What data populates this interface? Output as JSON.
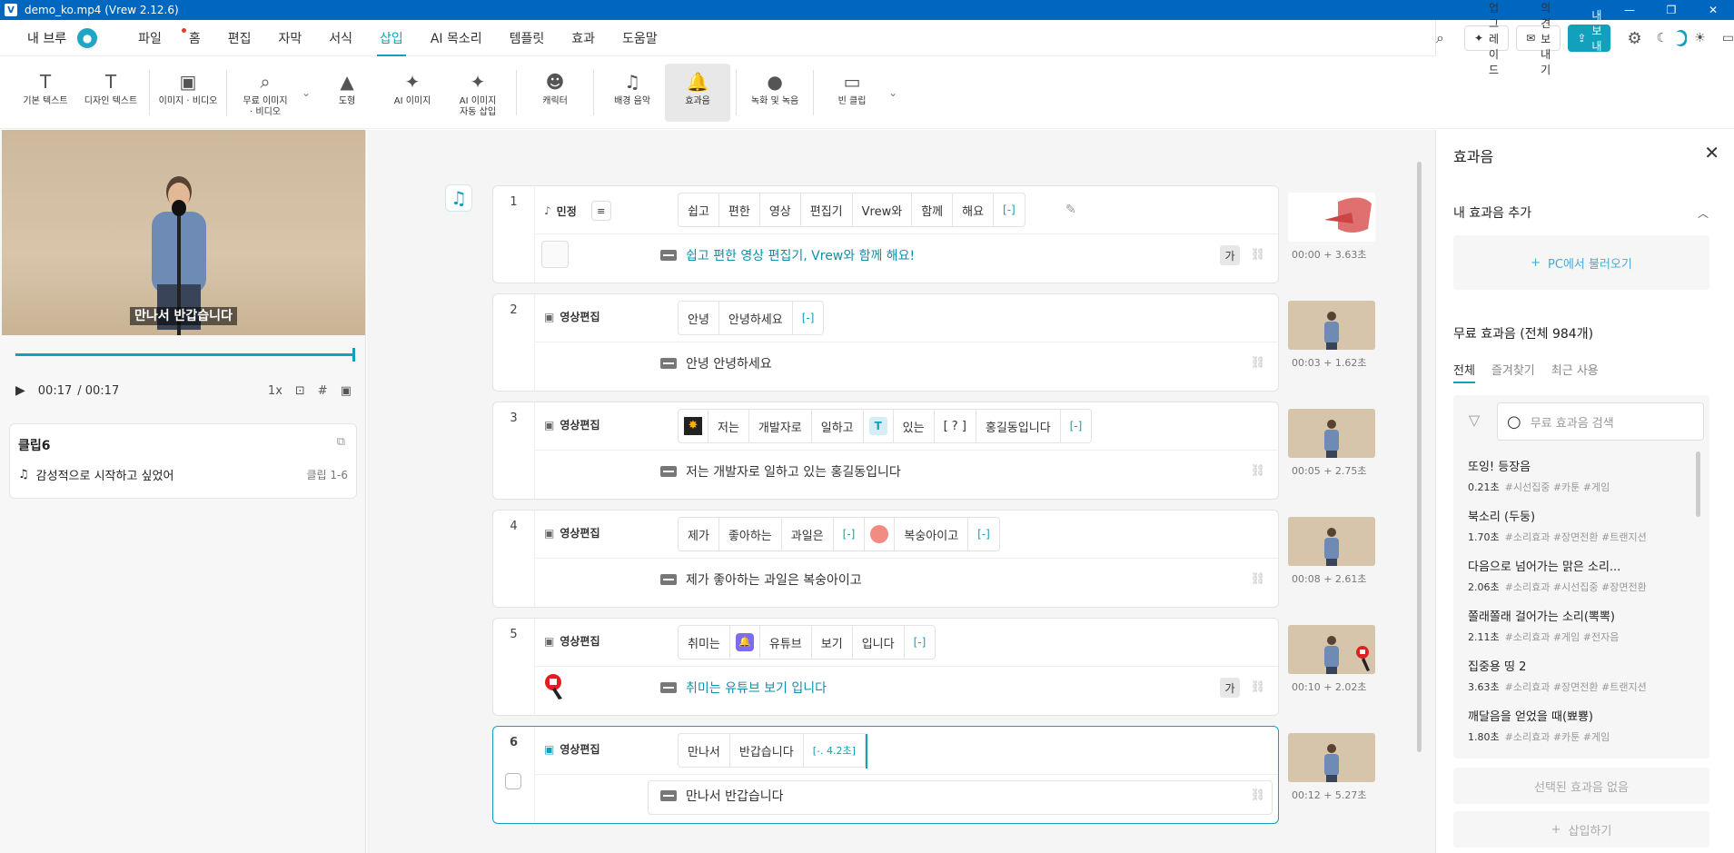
{
  "window": {
    "title": "demo_ko.mp4 (Vrew 2.12.6)",
    "controls": [
      "—",
      "❐",
      "✕"
    ]
  },
  "menubar": {
    "user": "내 브루",
    "items": [
      "파일",
      "홈",
      "편집",
      "자막",
      "서식",
      "삽입",
      "AI 목소리",
      "템플릿",
      "효과",
      "도움말"
    ],
    "active": "삽입",
    "upgrade": "업그레이드",
    "feedback": "의견 보내기",
    "export": "내보내기"
  },
  "toolbar": {
    "tools": [
      {
        "label1": "기본 텍스트",
        "label2": "",
        "icon": "T"
      },
      {
        "label1": "디자인 텍스트",
        "label2": "",
        "icon": "T"
      },
      {
        "label1": "이미지 · 비디오",
        "label2": "",
        "icon": "▣"
      },
      {
        "label1": "무료 이미지",
        "label2": "· 비디오",
        "icon": "⌕"
      },
      {
        "label1": "도형",
        "label2": "",
        "icon": "▲"
      },
      {
        "label1": "AI 이미지",
        "label2": "",
        "icon": "✦"
      },
      {
        "label1": "AI 이미지",
        "label2": "자동 삽입",
        "icon": "✦"
      },
      {
        "label1": "캐릭터",
        "label2": "",
        "icon": "☻"
      },
      {
        "label1": "배경 음악",
        "label2": "",
        "icon": "♫"
      },
      {
        "label1": "효과음",
        "label2": "",
        "icon": "🔔"
      },
      {
        "label1": "녹화 및 녹음",
        "label2": "",
        "icon": "●"
      },
      {
        "label1": "빈 클립",
        "label2": "",
        "icon": "▭"
      }
    ]
  },
  "player": {
    "subtitle": "만나서 반갑습니다",
    "current": "00:17",
    "total": "/ 00:17",
    "speed": "1x",
    "progress_fraction": 1.0
  },
  "clipcard": {
    "title": "클립6",
    "bgm_name": "감성적으로 시작하고 싶었어",
    "range": "클립 1-6"
  },
  "clips": [
    {
      "num": "1",
      "speaker": "민정",
      "words": [
        "쉽고",
        "편한",
        "영상",
        "편집기",
        "Vrew와",
        "함께",
        "해요",
        "[-]"
      ],
      "subtitle": "쉽고 편한 영상 편집기, Vrew와 함께 해요!",
      "time": "00:00 + 3.63초",
      "ga": "가"
    },
    {
      "num": "2",
      "speaker": "영상편집",
      "words": [
        "안녕",
        "안녕하세요",
        "[-]"
      ],
      "subtitle": "안녕 안녕하세요",
      "time": "00:03 + 1.62초"
    },
    {
      "num": "3",
      "speaker": "영상편집",
      "words": [
        "저는",
        "개발자로",
        "일하고",
        "있는",
        "[ ? ]",
        "홍길동입니다",
        "[-]"
      ],
      "subtitle": "저는 개발자로 일하고 있는 홍길동입니다",
      "time": "00:05 + 2.75초"
    },
    {
      "num": "4",
      "speaker": "영상편집",
      "words": [
        "제가",
        "좋아하는",
        "과일은",
        "[-]",
        "복숭아이고",
        "[-]"
      ],
      "subtitle": "제가 좋아하는 과일은 복숭아이고",
      "time": "00:08 + 2.61초"
    },
    {
      "num": "5",
      "speaker": "영상편집",
      "words": [
        "취미는",
        "유튜브",
        "보기",
        "입니다",
        "[-]"
      ],
      "subtitle": "취미는 유튜브 보기 입니다",
      "time": "00:10 + 2.02초",
      "ga": "가"
    },
    {
      "num": "6",
      "speaker": "영상편집",
      "words": [
        "만나서",
        "반갑습니다",
        "[-. 4.2초]"
      ],
      "subtitle": "만나서 반갑습니다",
      "time": "00:12 + 5.27초"
    }
  ],
  "sfx_panel": {
    "title": "효과음",
    "my_section": "내 효과음 추가",
    "load_pc": "PC에서 불러오기",
    "free_section": "무료 효과음 (전체 984개)",
    "tabs": [
      "전체",
      "즐겨찾기",
      "최근 사용"
    ],
    "search_placeholder": "무료 효과음 검색",
    "items": [
      {
        "name": "또잉! 등장음",
        "dur": "0.21초",
        "tags": "#시선집중 #카툰 #게임"
      },
      {
        "name": "북소리 (두둥)",
        "dur": "1.70초",
        "tags": "#소리효과 #장면전환 #트랜지션"
      },
      {
        "name": "다음으로 넘어가는 맑은 소리...",
        "dur": "2.06초",
        "tags": "#소리효과 #시선집중 #장면전환"
      },
      {
        "name": "쫄래쫄래 걸어가는 소리(뽁뽁)",
        "dur": "2.11초",
        "tags": "#소리효과 #게임 #전자음"
      },
      {
        "name": "집중용 띵 2",
        "dur": "3.63초",
        "tags": "#소리효과 #장면전환 #트랜지션"
      },
      {
        "name": "깨달음을 얻었을 때(뾰뿅)",
        "dur": "1.80초",
        "tags": "#소리효과 #카툰 #게임"
      }
    ],
    "none_selected": "선택된 효과음 없음",
    "insert": "삽입하기"
  },
  "colors": {
    "accent": "#12a0bd",
    "titlebar": "#0067c0"
  }
}
